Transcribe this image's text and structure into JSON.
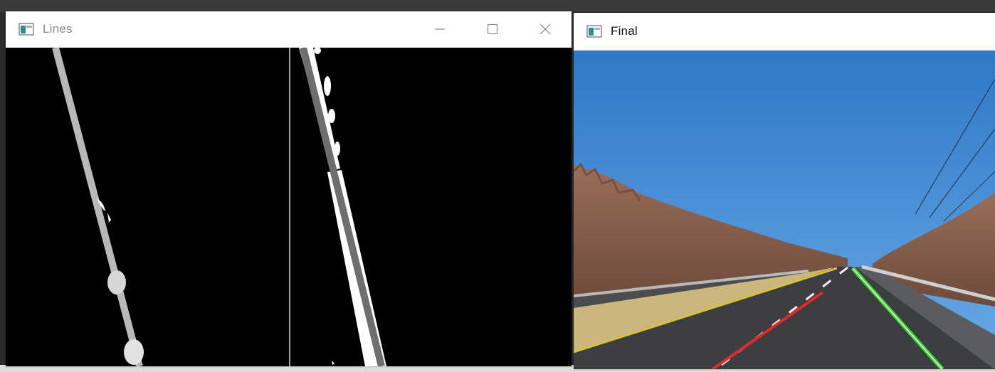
{
  "windows": {
    "lines": {
      "title": "Lines",
      "icon": "window-app-icon",
      "controls": [
        "minimize-icon",
        "maximize-icon",
        "close-icon"
      ]
    },
    "final": {
      "title": "Final",
      "icon": "window-app-icon"
    }
  },
  "colors": {
    "mask_background": "#000000",
    "mask_white": "#ffffff",
    "fitted_left_line": "#b8b8b8",
    "fitted_right_line": "#6e6e6e",
    "sky": "#3f86cf",
    "trees": "#8a5a47",
    "grass": "#c9b77d",
    "road": "#3c3e42",
    "lane_left_overlay": "#e02a2a",
    "lane_right_overlay": "#3bd52a",
    "yellow_edge_line": "#d9c23a"
  }
}
